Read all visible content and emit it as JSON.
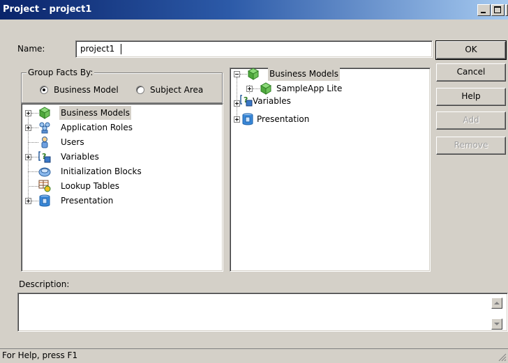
{
  "window": {
    "title": "Project - project1",
    "controls": [
      "minimize-icon",
      "maximize-icon",
      "close-icon"
    ]
  },
  "name_field": {
    "label": "Name:",
    "value": "project1"
  },
  "group_facts": {
    "legend": "Group Facts By:",
    "options": [
      {
        "label": "Business Model",
        "selected": true
      },
      {
        "label": "Subject Area",
        "selected": false
      }
    ]
  },
  "left_tree": {
    "items": [
      {
        "label": "Business Models",
        "icon": "business-model-icon",
        "expandable": true,
        "selected": true
      },
      {
        "label": "Application Roles",
        "icon": "roles-icon",
        "expandable": true,
        "selected": false
      },
      {
        "label": "Users",
        "icon": "user-icon",
        "expandable": false,
        "selected": false
      },
      {
        "label": "Variables",
        "icon": "variables-icon",
        "expandable": true,
        "selected": false
      },
      {
        "label": "Initialization Blocks",
        "icon": "init-block-icon",
        "expandable": false,
        "selected": false
      },
      {
        "label": "Lookup Tables",
        "icon": "lookup-table-icon",
        "expandable": false,
        "selected": false
      },
      {
        "label": "Presentation",
        "icon": "presentation-icon",
        "expandable": true,
        "selected": false
      }
    ]
  },
  "right_tree": {
    "items": [
      {
        "label": "Business Models",
        "icon": "business-model-icon",
        "expanded": true,
        "selected": true
      },
      {
        "label": "SampleApp Lite",
        "icon": "business-model-icon",
        "child": true
      },
      {
        "label": "Variables",
        "icon": "variables-icon"
      },
      {
        "label": "Presentation",
        "icon": "presentation-icon"
      }
    ]
  },
  "buttons": {
    "ok": "OK",
    "cancel": "Cancel",
    "help": "Help",
    "add": "Add",
    "remove": "Remove"
  },
  "description": {
    "label": "Description:",
    "value": ""
  },
  "status_bar": {
    "text": "For Help, press F1"
  }
}
